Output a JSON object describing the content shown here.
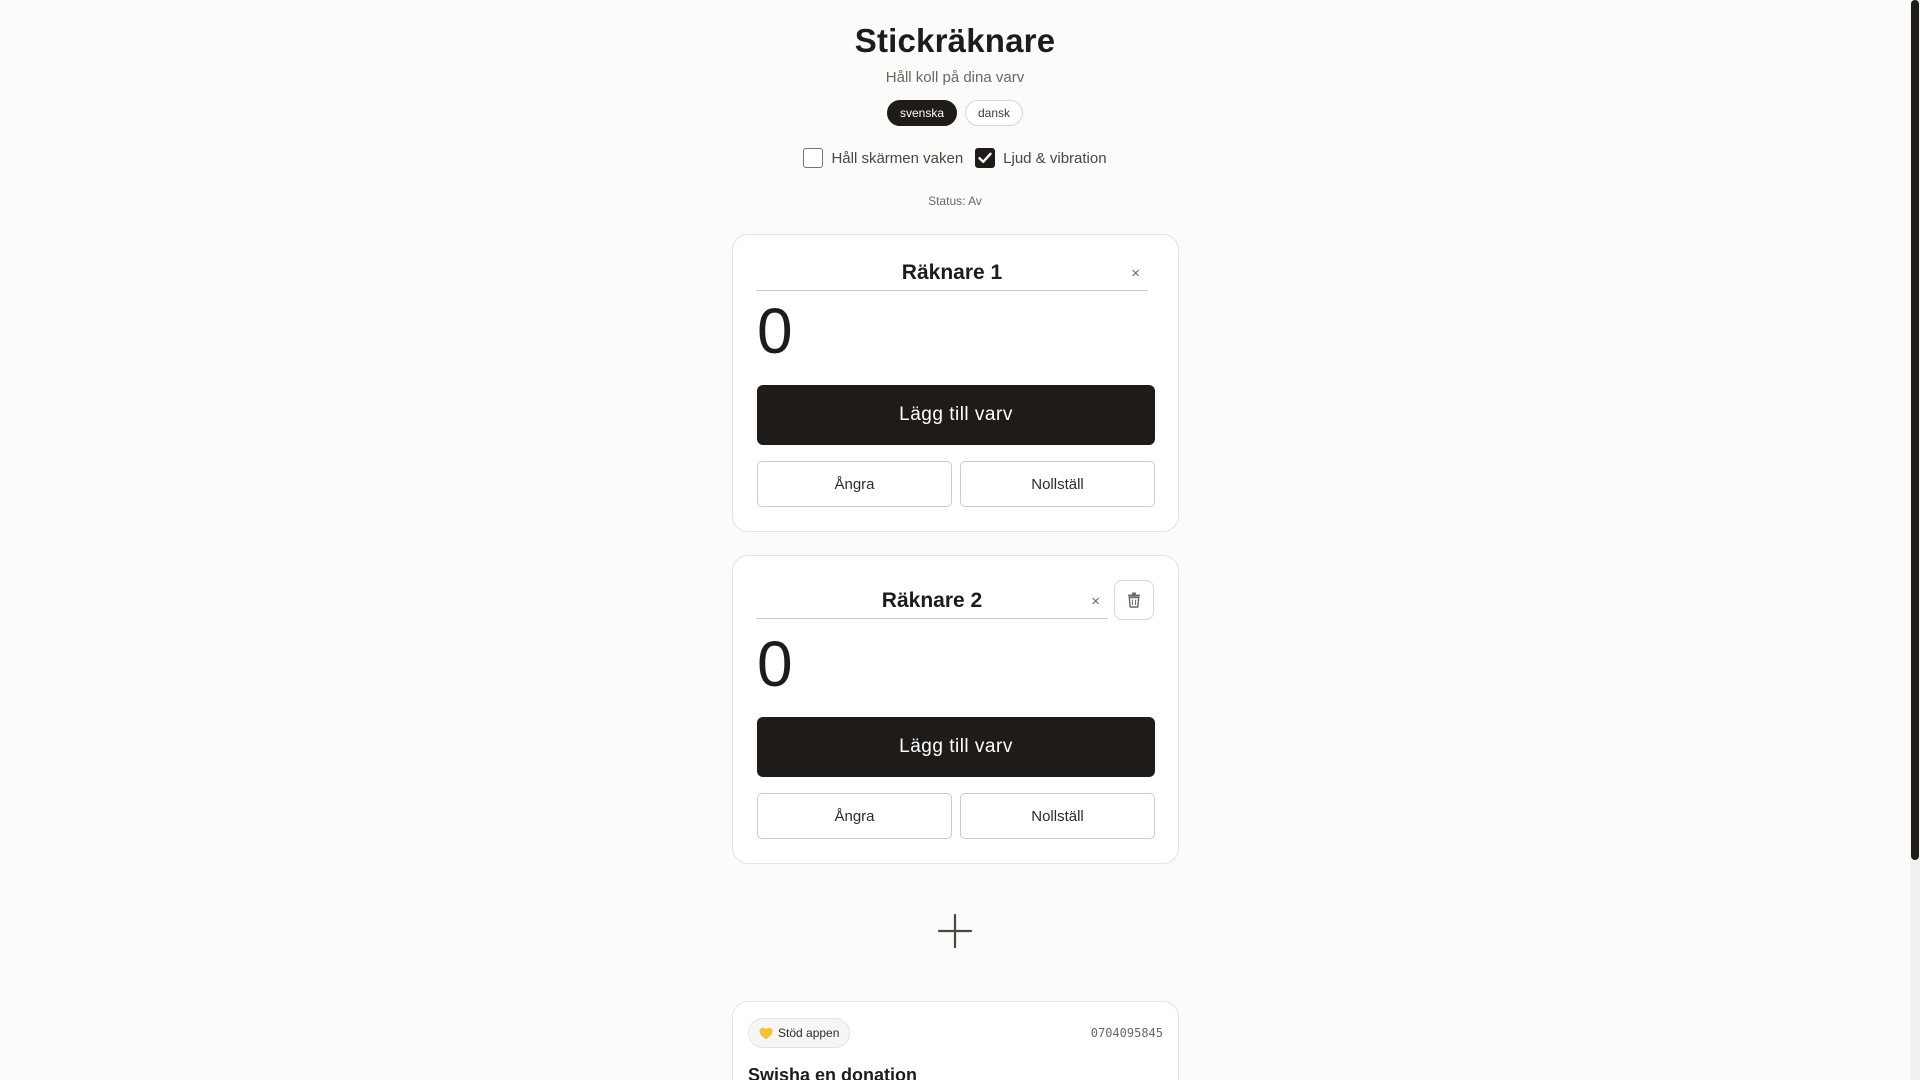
{
  "app": {
    "title": "Stickräknare",
    "subtitle": "Håll koll på dina varv"
  },
  "languages": [
    {
      "label": "svenska",
      "active": true
    },
    {
      "label": "dansk",
      "active": false
    }
  ],
  "options": {
    "keep_awake": {
      "label": "Håll skärmen vaken",
      "checked": false
    },
    "sound_vibration": {
      "label": "Ljud & vibration",
      "checked": true
    }
  },
  "status": "Status: Av",
  "counters": [
    {
      "name": "Räknare 1",
      "count": "0",
      "clear_symbol": "×",
      "add_label": "Lägg till varv",
      "undo_label": "Ångra",
      "reset_label": "Nollställ",
      "deletable": false
    },
    {
      "name": "Räknare 2",
      "count": "0",
      "clear_symbol": "×",
      "add_label": "Lägg till varv",
      "undo_label": "Ångra",
      "reset_label": "Nollställ",
      "deletable": true
    }
  ],
  "icons": {
    "clear": "close-icon",
    "delete": "trash-icon",
    "add_counter": "plus-icon",
    "support": "heart-icon"
  },
  "donation": {
    "support_label": "Stöd appen",
    "phone": "0704095845",
    "heading": "Swisha en donation"
  },
  "colors": {
    "primary": "#1e1b19",
    "background": "#fbfbfa",
    "heart": "#f2c233"
  }
}
